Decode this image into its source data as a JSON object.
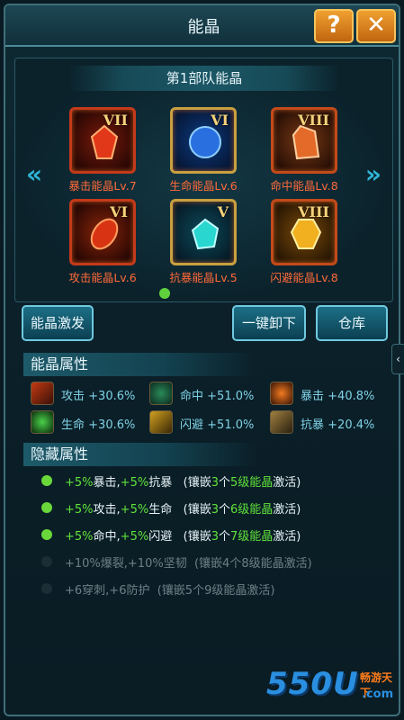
{
  "window": {
    "title": "能晶",
    "help_label": "?",
    "close_label": "✕"
  },
  "panel": {
    "team_title": "第1部队能晶",
    "prev_arrow": "«",
    "next_arrow": "»",
    "gems": [
      {
        "roman": "VII",
        "label": "暴击能晶Lv.7",
        "color": "#e2381a",
        "icon": "red-crystal-icon"
      },
      {
        "roman": "VI",
        "label": "生命能晶Lv.6",
        "color": "#2a6fe0",
        "icon": "blue-orb-icon"
      },
      {
        "roman": "VIII",
        "label": "命中能晶Lv.8",
        "color": "#e46a2a",
        "icon": "orange-crystal-icon"
      },
      {
        "roman": "VI",
        "label": "攻击能晶Lv.6",
        "color": "#d83414",
        "icon": "fire-gem-icon"
      },
      {
        "roman": "V",
        "label": "抗暴能晶Lv.5",
        "color": "#2ad6d0",
        "icon": "cyan-gem-icon"
      },
      {
        "roman": "VIII",
        "label": "闪避能晶Lv.8",
        "color": "#f0b020",
        "icon": "gold-gem-icon"
      }
    ]
  },
  "buttons": {
    "activate": "能晶激发",
    "unload_all": "一键卸下",
    "warehouse": "仓库"
  },
  "attributes": {
    "title": "能晶属性",
    "items": [
      {
        "name": "攻击",
        "value": "+30.6%",
        "icon": "sword-icon"
      },
      {
        "name": "命中",
        "value": "+51.0%",
        "icon": "crosshair-icon"
      },
      {
        "name": "暴击",
        "value": "+40.8%",
        "icon": "burst-icon"
      },
      {
        "name": "生命",
        "value": "+30.6%",
        "icon": "heart-icon"
      },
      {
        "name": "闪避",
        "value": "+51.0%",
        "icon": "dodge-icon"
      },
      {
        "name": "抗暴",
        "value": "+20.4%",
        "icon": "shield-icon"
      }
    ]
  },
  "hidden": {
    "title": "隐藏属性",
    "rows": [
      {
        "active": true,
        "bonus_a": "+5%",
        "name_a": "暴击,",
        "bonus_b": "+5%",
        "name_b": "抗暴",
        "req_pre": "(镶嵌",
        "count": "3",
        "req_mid": "个",
        "level": "5级能晶",
        "req_post": "激活)"
      },
      {
        "active": true,
        "bonus_a": "+5%",
        "name_a": "攻击,",
        "bonus_b": "+5%",
        "name_b": "生命",
        "req_pre": "(镶嵌",
        "count": "3",
        "req_mid": "个",
        "level": "6级能晶",
        "req_post": "激活)"
      },
      {
        "active": true,
        "bonus_a": "+5%",
        "name_a": "命中,",
        "bonus_b": "+5%",
        "name_b": "闪避",
        "req_pre": "(镶嵌",
        "count": "3",
        "req_mid": "个",
        "level": "7级能晶",
        "req_post": "激活)"
      },
      {
        "active": false,
        "text": "+10%爆裂,+10%坚韧",
        "req": "(镶嵌4个8级能晶激活)"
      },
      {
        "active": false,
        "text": "+6穿刺,+6防护",
        "req": "(镶嵌5个9级能晶激活)"
      }
    ]
  },
  "side_tab": "‹",
  "watermark": {
    "brand": "550U",
    "slogan": "畅游天下",
    "domain": ".com"
  }
}
